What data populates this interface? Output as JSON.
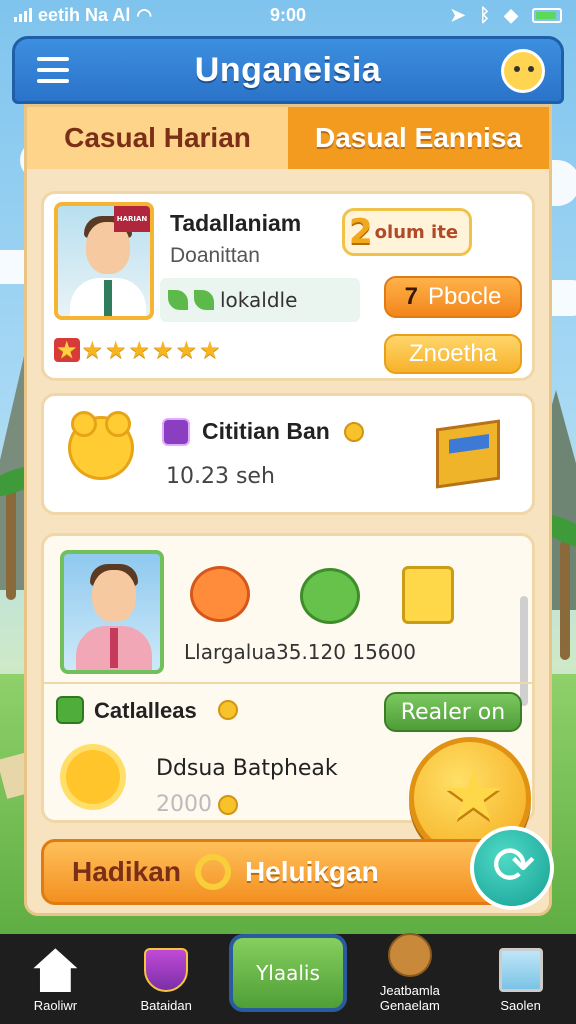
{
  "status_bar": {
    "carrier": "eetih Na Al",
    "time": "9:00"
  },
  "header": {
    "title": "Unganeisia"
  },
  "tabs": [
    {
      "label": "Casual Harian"
    },
    {
      "label": "Dasual Eannisa"
    }
  ],
  "profile_card": {
    "avatar_badge": "HARIAN",
    "name": "Tadallaniam",
    "subtitle": "Doanittan",
    "badge_number": "2",
    "badge_text": "olum ite",
    "status_label": "lokaldle",
    "level_number": "7",
    "level_label": "Pbocle",
    "secondary_button": "Znoetha",
    "stars": [
      "★",
      "★",
      "★",
      "★",
      "★",
      "★",
      "★"
    ]
  },
  "timer_card": {
    "name": "Cititian Ban",
    "time": "10.23 seh"
  },
  "reward_card": {
    "stats_label": "Llargalua",
    "stats_values": "35.120 15600",
    "section_title": "Catlalleas",
    "green_button": "Realer on",
    "daily_title": "Ddsua Batpheak",
    "daily_value": "2000"
  },
  "action_button": {
    "left_label": "Hadikan",
    "right_label": "Heluikgan"
  },
  "bottom_nav": [
    {
      "label": "Raoliwr",
      "icon": "home-icon"
    },
    {
      "label": "Bataidan",
      "icon": "shield-icon"
    },
    {
      "label": "Ylaalis",
      "icon": "center-button"
    },
    {
      "label": "Jeatbamla Genaelam",
      "icon": "bear-icon"
    },
    {
      "label": "Saolen",
      "icon": "window-icon"
    }
  ],
  "colors": {
    "header_blue": "#2a73c9",
    "tab_orange": "#f39b1f",
    "panel_cream": "#f7e3bf",
    "accent_green": "#4e9d37",
    "coin_gold": "#f4a91b"
  }
}
